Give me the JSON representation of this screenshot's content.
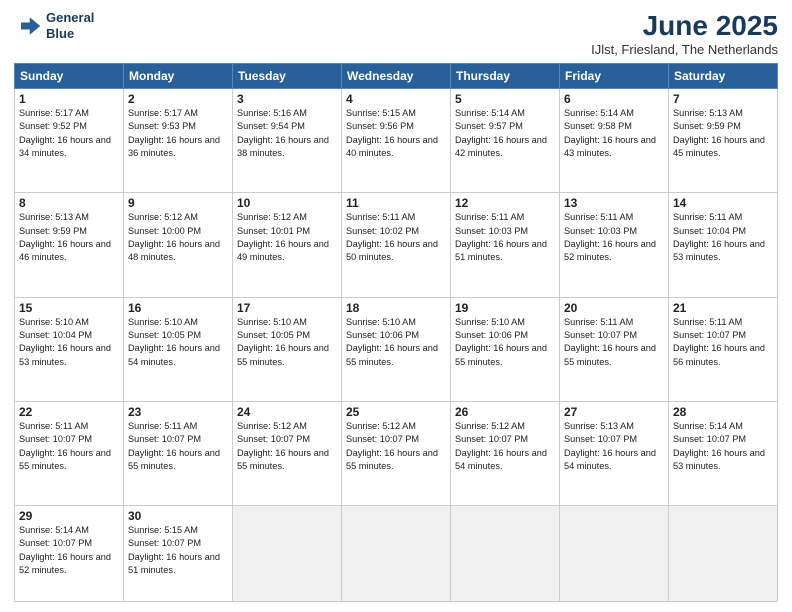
{
  "header": {
    "logo_line1": "General",
    "logo_line2": "Blue",
    "month_title": "June 2025",
    "location": "IJlst, Friesland, The Netherlands"
  },
  "weekdays": [
    "Sunday",
    "Monday",
    "Tuesday",
    "Wednesday",
    "Thursday",
    "Friday",
    "Saturday"
  ],
  "days": [
    {
      "date": "",
      "info": ""
    },
    {
      "date": "",
      "info": ""
    },
    {
      "date": "",
      "info": ""
    },
    {
      "date": "",
      "info": ""
    },
    {
      "date": "",
      "info": ""
    },
    {
      "date": "",
      "info": ""
    },
    {
      "date": "",
      "info": ""
    },
    {
      "date": "1",
      "rise": "5:17 AM",
      "set": "9:52 PM",
      "daylight": "16 hours and 34 minutes."
    },
    {
      "date": "2",
      "rise": "5:17 AM",
      "set": "9:53 PM",
      "daylight": "16 hours and 36 minutes."
    },
    {
      "date": "3",
      "rise": "5:16 AM",
      "set": "9:54 PM",
      "daylight": "16 hours and 38 minutes."
    },
    {
      "date": "4",
      "rise": "5:15 AM",
      "set": "9:56 PM",
      "daylight": "16 hours and 40 minutes."
    },
    {
      "date": "5",
      "rise": "5:14 AM",
      "set": "9:57 PM",
      "daylight": "16 hours and 42 minutes."
    },
    {
      "date": "6",
      "rise": "5:14 AM",
      "set": "9:58 PM",
      "daylight": "16 hours and 43 minutes."
    },
    {
      "date": "7",
      "rise": "5:13 AM",
      "set": "9:59 PM",
      "daylight": "16 hours and 45 minutes."
    },
    {
      "date": "8",
      "rise": "5:13 AM",
      "set": "9:59 PM",
      "daylight": "16 hours and 46 minutes."
    },
    {
      "date": "9",
      "rise": "5:12 AM",
      "set": "10:00 PM",
      "daylight": "16 hours and 48 minutes."
    },
    {
      "date": "10",
      "rise": "5:12 AM",
      "set": "10:01 PM",
      "daylight": "16 hours and 49 minutes."
    },
    {
      "date": "11",
      "rise": "5:11 AM",
      "set": "10:02 PM",
      "daylight": "16 hours and 50 minutes."
    },
    {
      "date": "12",
      "rise": "5:11 AM",
      "set": "10:03 PM",
      "daylight": "16 hours and 51 minutes."
    },
    {
      "date": "13",
      "rise": "5:11 AM",
      "set": "10:03 PM",
      "daylight": "16 hours and 52 minutes."
    },
    {
      "date": "14",
      "rise": "5:11 AM",
      "set": "10:04 PM",
      "daylight": "16 hours and 53 minutes."
    },
    {
      "date": "15",
      "rise": "5:10 AM",
      "set": "10:04 PM",
      "daylight": "16 hours and 53 minutes."
    },
    {
      "date": "16",
      "rise": "5:10 AM",
      "set": "10:05 PM",
      "daylight": "16 hours and 54 minutes."
    },
    {
      "date": "17",
      "rise": "5:10 AM",
      "set": "10:05 PM",
      "daylight": "16 hours and 55 minutes."
    },
    {
      "date": "18",
      "rise": "5:10 AM",
      "set": "10:06 PM",
      "daylight": "16 hours and 55 minutes."
    },
    {
      "date": "19",
      "rise": "5:10 AM",
      "set": "10:06 PM",
      "daylight": "16 hours and 55 minutes."
    },
    {
      "date": "20",
      "rise": "5:11 AM",
      "set": "10:07 PM",
      "daylight": "16 hours and 55 minutes."
    },
    {
      "date": "21",
      "rise": "5:11 AM",
      "set": "10:07 PM",
      "daylight": "16 hours and 56 minutes."
    },
    {
      "date": "22",
      "rise": "5:11 AM",
      "set": "10:07 PM",
      "daylight": "16 hours and 55 minutes."
    },
    {
      "date": "23",
      "rise": "5:11 AM",
      "set": "10:07 PM",
      "daylight": "16 hours and 55 minutes."
    },
    {
      "date": "24",
      "rise": "5:12 AM",
      "set": "10:07 PM",
      "daylight": "16 hours and 55 minutes."
    },
    {
      "date": "25",
      "rise": "5:12 AM",
      "set": "10:07 PM",
      "daylight": "16 hours and 55 minutes."
    },
    {
      "date": "26",
      "rise": "5:12 AM",
      "set": "10:07 PM",
      "daylight": "16 hours and 54 minutes."
    },
    {
      "date": "27",
      "rise": "5:13 AM",
      "set": "10:07 PM",
      "daylight": "16 hours and 54 minutes."
    },
    {
      "date": "28",
      "rise": "5:14 AM",
      "set": "10:07 PM",
      "daylight": "16 hours and 53 minutes."
    },
    {
      "date": "29",
      "rise": "5:14 AM",
      "set": "10:07 PM",
      "daylight": "16 hours and 52 minutes."
    },
    {
      "date": "30",
      "rise": "5:15 AM",
      "set": "10:07 PM",
      "daylight": "16 hours and 51 minutes."
    },
    {
      "date": "",
      "info": ""
    },
    {
      "date": "",
      "info": ""
    },
    {
      "date": "",
      "info": ""
    },
    {
      "date": "",
      "info": ""
    },
    {
      "date": "",
      "info": ""
    }
  ]
}
